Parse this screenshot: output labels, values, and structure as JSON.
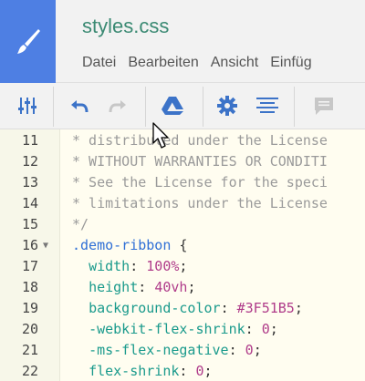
{
  "app": {
    "title": "styles.css",
    "menu": [
      "Datei",
      "Bearbeiten",
      "Ansicht",
      "Einfüg"
    ]
  },
  "icons": {
    "logo": "brush-icon",
    "settings": "sliders-icon",
    "undo": "undo-icon",
    "redo": "redo-icon",
    "drive": "google-drive-icon",
    "gear": "gear-icon",
    "align": "align-center-icon",
    "comment": "comment-icon"
  },
  "colors": {
    "logo_bg": "#4e7fe3",
    "title": "#3b8a73",
    "toolbar_icon": "#3c73c8",
    "disabled_icon": "#c7c7c7"
  },
  "code": {
    "lines": [
      {
        "num": "11",
        "fold": "",
        "text": "* distributed under the License",
        "kind": "comment"
      },
      {
        "num": "12",
        "fold": "",
        "text": "* WITHOUT WARRANTIES OR CONDITI",
        "kind": "comment"
      },
      {
        "num": "13",
        "fold": "",
        "text": "* See the License for the speci",
        "kind": "comment"
      },
      {
        "num": "14",
        "fold": "",
        "text": "* limitations under the License",
        "kind": "comment"
      },
      {
        "num": "15",
        "fold": "",
        "text": "*/",
        "kind": "comment"
      },
      {
        "num": "16",
        "fold": "▼",
        "selector": ".demo-ribbon",
        "rest": " {",
        "kind": "selector"
      },
      {
        "num": "17",
        "fold": "",
        "prop": "width",
        "value": "100%",
        "kind": "decl"
      },
      {
        "num": "18",
        "fold": "",
        "prop": "height",
        "value": "40vh",
        "kind": "decl"
      },
      {
        "num": "19",
        "fold": "",
        "prop": "background-color",
        "value": "#3F51B5",
        "kind": "decl"
      },
      {
        "num": "20",
        "fold": "",
        "prop": "-webkit-flex-shrink",
        "value": "0",
        "kind": "decl"
      },
      {
        "num": "21",
        "fold": "",
        "prop": "-ms-flex-negative",
        "value": "0",
        "kind": "decl"
      },
      {
        "num": "22",
        "fold": "",
        "prop": "flex-shrink",
        "value": "0",
        "kind": "decl"
      }
    ]
  }
}
